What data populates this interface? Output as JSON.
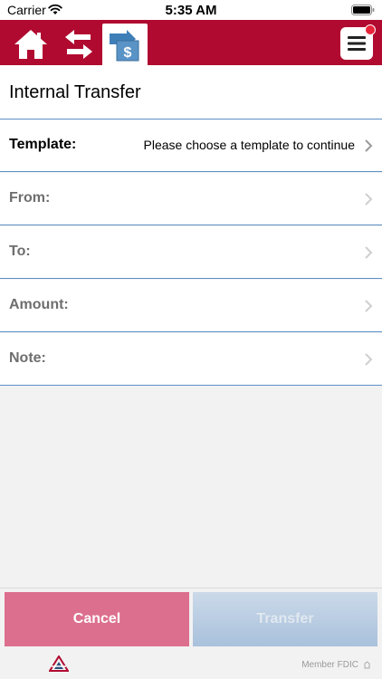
{
  "status_bar": {
    "carrier": "Carrier",
    "time": "5:35 AM"
  },
  "nav": {
    "icons": [
      "home-icon",
      "transfer-arrows-icon",
      "transfer-money-icon",
      "menu-icon"
    ],
    "brand_color": "#b00a30"
  },
  "page": {
    "title": "Internal Transfer"
  },
  "form": {
    "template_label": "Template:",
    "template_value": "Please choose a template to continue",
    "from_label": "From:",
    "to_label": "To:",
    "amount_label": "Amount:",
    "note_label": "Note:"
  },
  "actions": {
    "cancel_label": "Cancel",
    "transfer_label": "Transfer"
  },
  "footer": {
    "fdic_text": "Member FDIC"
  },
  "colors": {
    "divider": "#5a8fc6",
    "cancel": "#dc6f8e",
    "transfer_disabled": "#b7cbe2"
  }
}
